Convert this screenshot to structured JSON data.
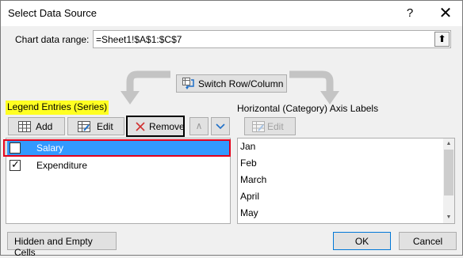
{
  "window": {
    "title": "Select Data Source",
    "help_glyph": "?",
    "close_glyph": "✕"
  },
  "data_range": {
    "label": "Chart data range:",
    "value": "=Sheet1!$A$1:$C$7",
    "collapse_glyph": "⬆"
  },
  "switch_button": {
    "label": "Switch Row/Column"
  },
  "legend_section": {
    "title": "Legend Entries (Series)",
    "add_label": "Add",
    "edit_label": "Edit",
    "remove_label": "Remove",
    "up_glyph": "∧",
    "down_glyph": "∨",
    "series": [
      {
        "name": "Salary",
        "checked": true,
        "selected": true
      },
      {
        "name": "Expenditure",
        "checked": true,
        "selected": false
      }
    ]
  },
  "axis_section": {
    "title": "Horizontal (Category) Axis Labels",
    "edit_label": "Edit",
    "labels": [
      "Jan",
      "Feb",
      "March",
      "April",
      "May"
    ],
    "scroll_up_glyph": "▲",
    "scroll_down_glyph": "▼"
  },
  "footer": {
    "hidden_label": "Hidden and Empty Cells",
    "ok_label": "OK",
    "cancel_label": "Cancel"
  },
  "colors": {
    "selection": "#3399ff",
    "highlight_frame": "#e3001b",
    "legend_highlight": "#ffff22",
    "remove_icon": "#d03030",
    "down_arrow": "#1e6fc8"
  },
  "checkmark_glyph": "✓"
}
